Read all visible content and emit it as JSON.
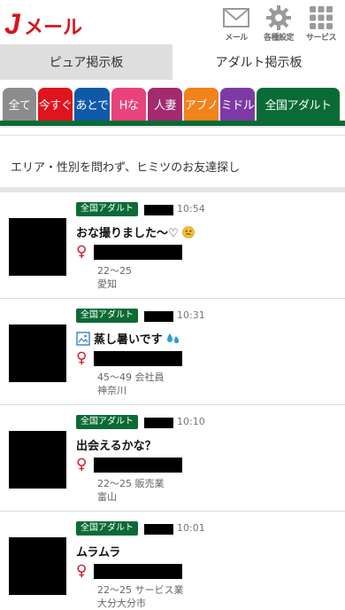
{
  "header": {
    "logo_text": "Jメール",
    "buttons": [
      {
        "label": "メール",
        "icon": "mail-icon"
      },
      {
        "label": "各種設定",
        "icon": "gear-icon"
      },
      {
        "label": "サービス",
        "icon": "grid-icon"
      }
    ]
  },
  "board_tabs": [
    {
      "label": "ピュア掲示板",
      "active": false
    },
    {
      "label": "アダルト掲示板",
      "active": true
    }
  ],
  "category_tabs": [
    {
      "label": "全て",
      "color": "#8c8c8c"
    },
    {
      "label": "今すぐ",
      "color": "#e0141c"
    },
    {
      "label": "あとで",
      "color": "#0f5aa8"
    },
    {
      "label": "Hな",
      "color": "#e8437a"
    },
    {
      "label": "人妻",
      "color": "#a32a6c"
    },
    {
      "label": "アブノ",
      "color": "#f2821c"
    },
    {
      "label": "ミドル",
      "color": "#7d3aa5"
    },
    {
      "label": "全国アダルト",
      "color": "#0a6b35"
    }
  ],
  "description": "エリア・性別を問わず、ヒミツのお友達探し",
  "posts": [
    {
      "badge": "全国アダルト",
      "time": "10:54",
      "title": "おな撮りました〜♡",
      "emoji": "smirk-face-icon",
      "gender": "♀",
      "age_job": "22〜25",
      "area": "愛知",
      "has_image": false
    },
    {
      "badge": "全国アダルト",
      "time": "10:31",
      "title": "蒸し暑いです",
      "emoji": "sweat-droplets-icon",
      "gender": "♀",
      "age_job": "45〜49 会社員",
      "area": "神奈川",
      "has_image": true
    },
    {
      "badge": "全国アダルト",
      "time": "10:10",
      "title": "出会えるかな？",
      "emoji": "",
      "gender": "♀",
      "age_job": "22〜25 販売業",
      "area": "富山",
      "has_image": false
    },
    {
      "badge": "全国アダルト",
      "time": "10:01",
      "title": "ムラムラ",
      "emoji": "",
      "gender": "♀",
      "age_job": "22〜25 サービス業",
      "area": "大分大分市",
      "has_image": false
    }
  ]
}
